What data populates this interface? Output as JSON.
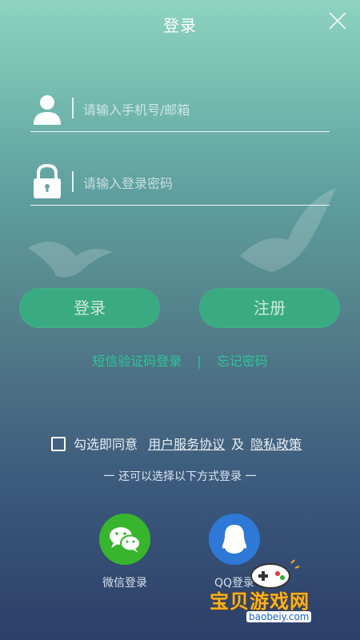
{
  "header": {
    "title": "登录"
  },
  "form": {
    "account_placeholder": "请输入手机号/邮箱",
    "password_placeholder": "请输入登录密码"
  },
  "buttons": {
    "login": "登录",
    "register": "注册"
  },
  "links": {
    "sms_login": "短信验证码登录",
    "separator": "|",
    "forgot_password": "忘记密码"
  },
  "agreement": {
    "prefix": "勾选即同意",
    "service": "用户服务协议",
    "and": "及",
    "privacy": "隐私政策"
  },
  "other_methods": "一 还可以选择以下方式登录 一",
  "social": [
    {
      "label": "微信登录",
      "icon": "wechat-icon",
      "color": "#37b52c"
    },
    {
      "label": "QQ登录",
      "icon": "qq-icon",
      "color": "#2d79d5"
    }
  ],
  "watermark": {
    "text": "宝贝游戏网",
    "url": "baobeiy.com"
  },
  "colors": {
    "button": "#3aaa83",
    "link": "#2bc59a"
  }
}
